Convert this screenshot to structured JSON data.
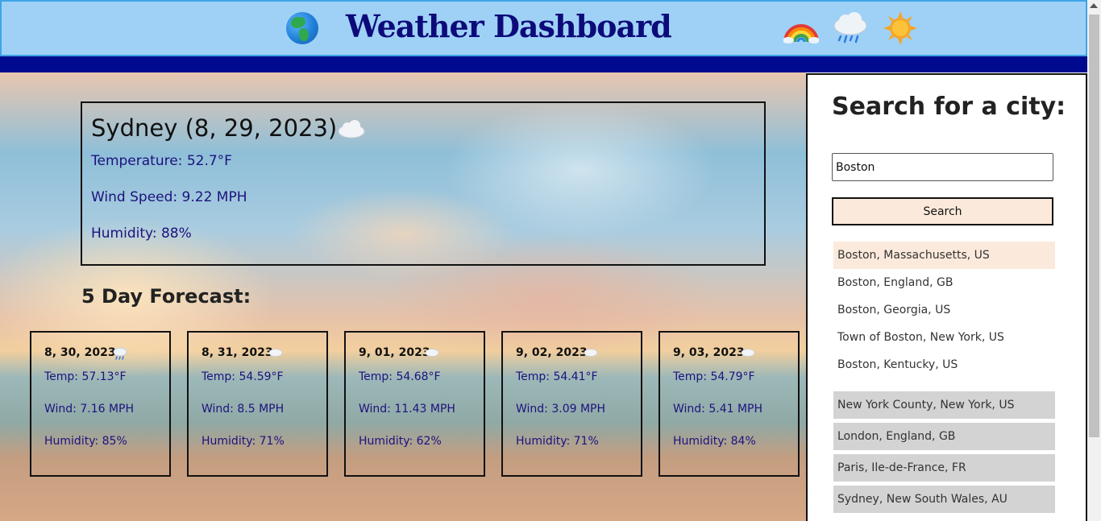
{
  "header": {
    "title": "Weather Dashboard",
    "icons": [
      "globe-icon",
      "rainbow-icon",
      "rain-cloud-icon",
      "sun-icon"
    ]
  },
  "current": {
    "city_date": "Sydney (8, 29, 2023)",
    "icon": "cloud-icon",
    "temperature": "Temperature: 52.7°F",
    "wind": "Wind Speed: 9.22 MPH",
    "humidity": "Humidity: 88%"
  },
  "forecast": {
    "title": "5 Day Forecast:",
    "days": [
      {
        "date": "8, 30, 2023",
        "icon": "rain-cloud-icon",
        "temp": "Temp: 57.13°F",
        "wind": "Wind: 7.16 MPH",
        "humidity": "Humidity: 85%"
      },
      {
        "date": "8, 31, 2023",
        "icon": "cloud-icon",
        "temp": "Temp: 54.59°F",
        "wind": "Wind: 8.5 MPH",
        "humidity": "Humidity: 71%"
      },
      {
        "date": "9, 01, 2023",
        "icon": "cloud-icon",
        "temp": "Temp: 54.68°F",
        "wind": "Wind: 11.43 MPH",
        "humidity": "Humidity: 62%"
      },
      {
        "date": "9, 02, 2023",
        "icon": "cloud-icon",
        "temp": "Temp: 54.41°F",
        "wind": "Wind: 3.09 MPH",
        "humidity": "Humidity: 71%"
      },
      {
        "date": "9, 03, 2023",
        "icon": "cloud-icon",
        "temp": "Temp: 54.79°F",
        "wind": "Wind: 5.41 MPH",
        "humidity": "Humidity: 84%"
      }
    ]
  },
  "sidebar": {
    "title": "Search for a city:",
    "search_value": "Boston",
    "search_button": "Search",
    "results": [
      "Boston, Massachusetts, US",
      "Boston, England, GB",
      "Boston, Georgia, US",
      "Town of Boston, New York, US",
      "Boston, Kentucky, US"
    ],
    "history": [
      "New York County, New York, US",
      "London, England, GB",
      "Paris, Ile-de-France, FR",
      "Sydney, New South Wales, AU"
    ]
  },
  "colors": {
    "header_bg": "#9fd1f7",
    "title": "#0d0b7a",
    "navy_bar": "#000a8f",
    "stat_text": "#1d127e",
    "highlight": "#fbeadb",
    "history_bg": "#d3d3d3"
  }
}
